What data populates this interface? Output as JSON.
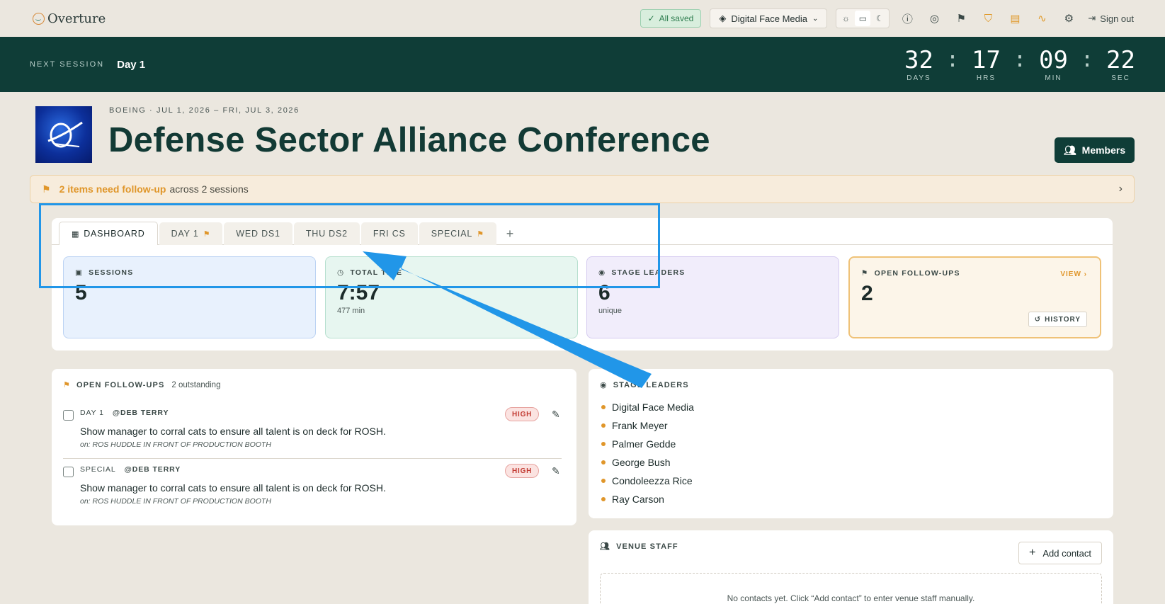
{
  "app": {
    "name": "Overture"
  },
  "topbar": {
    "saved_label": "All saved",
    "org_name": "Digital Face Media",
    "signout_label": "Sign out",
    "icons": [
      "help-icon",
      "support-icon",
      "flag-icon",
      "shield-icon",
      "scroll-icon",
      "activity-icon",
      "gear-icon"
    ]
  },
  "session_bar": {
    "label": "NEXT SESSION",
    "value": "Day 1",
    "countdown": [
      {
        "num": "32",
        "label": "DAYS"
      },
      {
        "num": "17",
        "label": "HRS"
      },
      {
        "num": "09",
        "label": "MIN"
      },
      {
        "num": "22",
        "label": "SEC"
      }
    ],
    "separator": ":"
  },
  "header": {
    "client": "BOEING",
    "dates": "· JUL 1, 2026 – FRI, JUL 3, 2026",
    "title": "Defense Sector Alliance Conference",
    "members_label": "Members"
  },
  "banner": {
    "highlight": "2 items need follow-up",
    "rest": "across 2 sessions"
  },
  "tabs": [
    {
      "label": "DASHBOARD",
      "active": true,
      "flag": false
    },
    {
      "label": "DAY 1",
      "active": false,
      "flag": true
    },
    {
      "label": "WED DS1",
      "active": false,
      "flag": false
    },
    {
      "label": "THU DS2",
      "active": false,
      "flag": false
    },
    {
      "label": "FRI CS",
      "active": false,
      "flag": false
    },
    {
      "label": "SPECIAL",
      "active": false,
      "flag": true
    }
  ],
  "tab_add": "+",
  "stats": {
    "sessions": {
      "label": "SESSIONS",
      "value": "5"
    },
    "total_time": {
      "label": "TOTAL TIME",
      "value": "7:57",
      "sub": "477 min"
    },
    "stage_leaders": {
      "label": "STAGE LEADERS",
      "value": "6",
      "sub": "unique"
    },
    "open_followups": {
      "label": "OPEN FOLLOW-UPS",
      "value": "2",
      "view": "VIEW ›",
      "history": "HISTORY"
    }
  },
  "followups": {
    "title": "OPEN FOLLOW-UPS",
    "count": "2 outstanding",
    "items": [
      {
        "session": "DAY 1",
        "owner": "@DEB TERRY",
        "priority": "HIGH",
        "text": "Show manager to corral cats to ensure all talent is on deck for ROSH.",
        "on": "on: ROS HUDDLE IN FRONT OF PRODUCTION BOOTH"
      },
      {
        "session": "SPECIAL",
        "owner": "@DEB TERRY",
        "priority": "HIGH",
        "text": "Show manager to corral cats to ensure all talent is on deck for ROSH.",
        "on": "on: ROS HUDDLE IN FRONT OF PRODUCTION BOOTH"
      }
    ]
  },
  "stage_leaders": {
    "title": "STAGE LEADERS",
    "names": [
      "Digital Face Media",
      "Frank Meyer",
      "Palmer Gedde",
      "George Bush",
      "Condoleezza Rice",
      "Ray Carson"
    ]
  },
  "venue_staff": {
    "title": "VENUE STAFF",
    "add_label": "Add contact",
    "empty_text": "No contacts yet. Click “Add contact” to enter venue staff manually."
  },
  "colors": {
    "brand_dark": "#0f3d37",
    "accent_orange": "#e0962a",
    "annotation_blue": "#2196e8"
  }
}
